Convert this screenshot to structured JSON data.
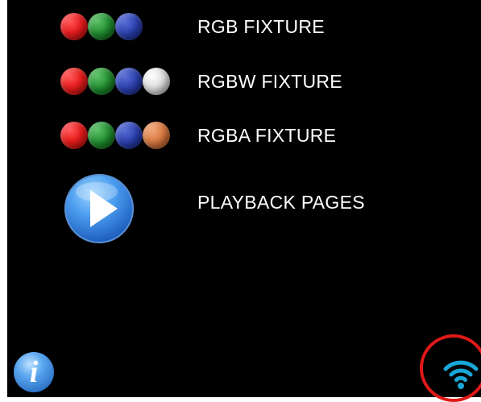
{
  "menu": {
    "items": [
      {
        "label": "RGB FIXTURE",
        "dots": [
          "#e81c1c",
          "#1f8a2d",
          "#2a3fae"
        ]
      },
      {
        "label": "RGBW FIXTURE",
        "dots": [
          "#e81c1c",
          "#1f8a2d",
          "#2a3fae",
          "#d8d8d8"
        ]
      },
      {
        "label": "RGBA FIXTURE",
        "dots": [
          "#e81c1c",
          "#1f8a2d",
          "#2a3fae",
          "#d5763f"
        ]
      },
      {
        "label": "PLAYBACK PAGES",
        "icon": "play-icon"
      }
    ]
  },
  "footer": {
    "info_icon": "info-icon",
    "info_glyph": "i",
    "wifi_icon": "wifi-icon",
    "wifi_color": "#1aa6d6",
    "highlight_color": "#e01818"
  },
  "colors": {
    "background": "#000000",
    "text": "#ffffff"
  }
}
